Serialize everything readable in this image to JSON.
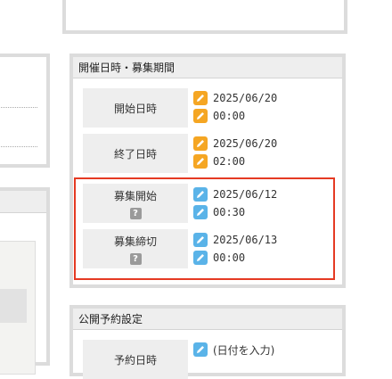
{
  "colors": {
    "panel_border": "#dcdcdc",
    "title_bar": "#eeeeee",
    "highlight": "#e53a23",
    "pencil_orange": "#f5a623",
    "pencil_blue": "#5ab3e8"
  },
  "schedule": {
    "title": "開催日時・募集期間",
    "rows": [
      {
        "label": "開始日時",
        "has_help": false,
        "date": "2025/06/20",
        "time": "00:00",
        "icon": "pencil-icon",
        "icon_color": "#f5a623"
      },
      {
        "label": "終了日時",
        "has_help": false,
        "date": "2025/06/20",
        "time": "02:00",
        "icon": "pencil-icon",
        "icon_color": "#f5a623"
      },
      {
        "label": "募集開始",
        "has_help": true,
        "help_text": "?",
        "date": "2025/06/12",
        "time": "00:30",
        "icon": "pencil-icon",
        "icon_color": "#5ab3e8"
      },
      {
        "label": "募集締切",
        "has_help": true,
        "help_text": "?",
        "date": "2025/06/13",
        "time": "00:00",
        "icon": "pencil-icon",
        "icon_color": "#5ab3e8"
      }
    ]
  },
  "publish": {
    "title": "公開予約設定",
    "row": {
      "label": "予約日時",
      "value": "(日付を入力)",
      "icon": "pencil-icon",
      "icon_color": "#5ab3e8"
    }
  }
}
